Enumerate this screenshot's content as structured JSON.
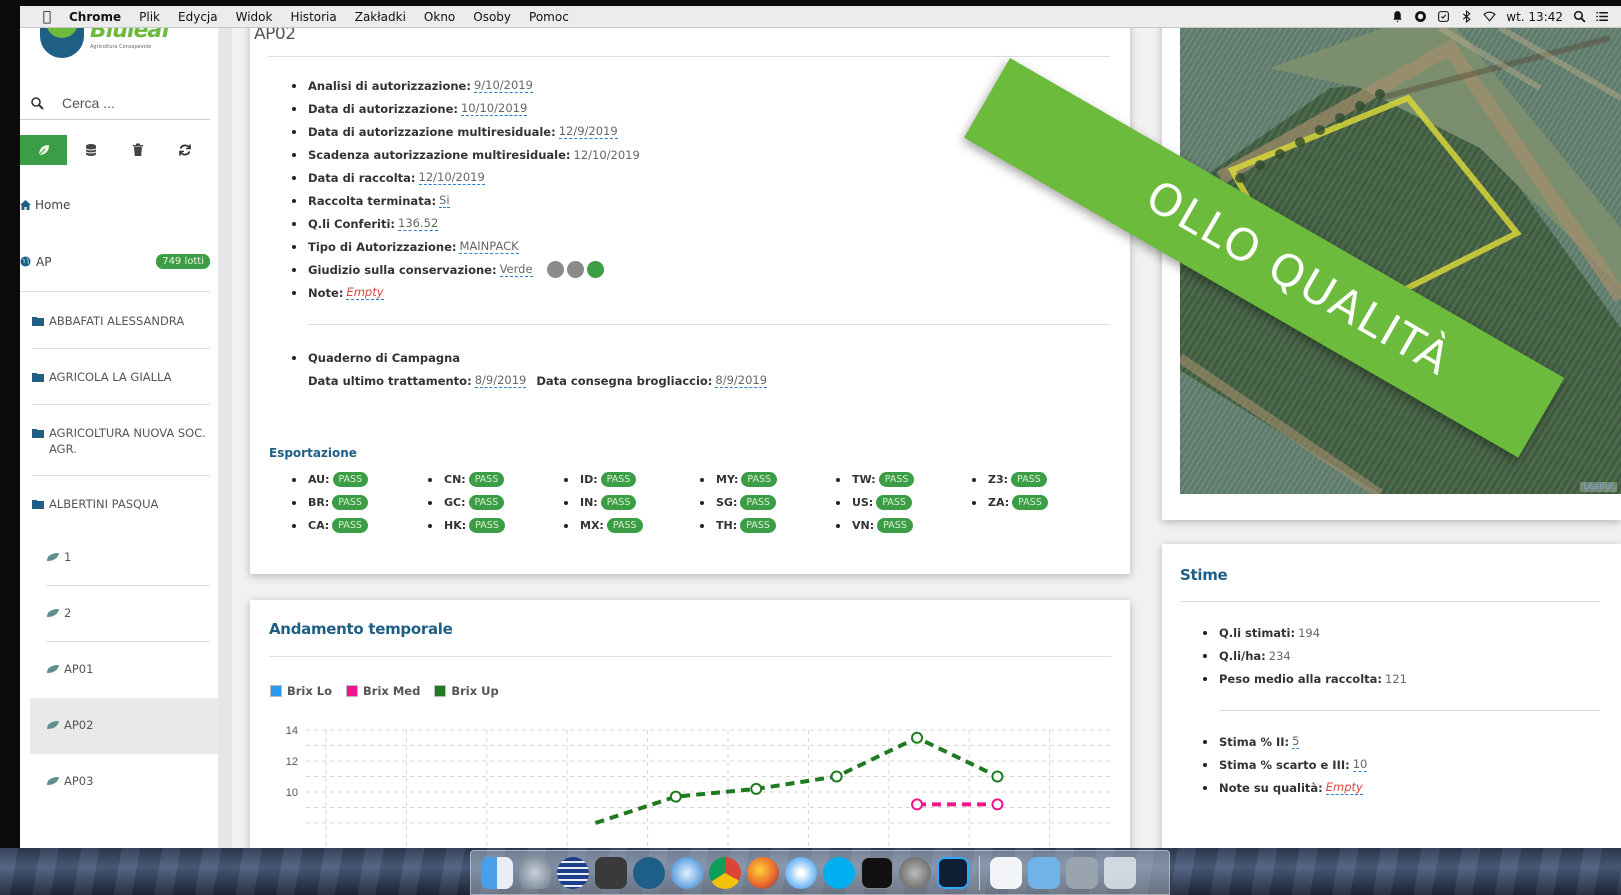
{
  "menubar": {
    "items": [
      "Chrome",
      "Plik",
      "Edycja",
      "Widok",
      "Historia",
      "Zakładki",
      "Okno",
      "Osoby",
      "Pomoc"
    ],
    "clock": "wt. 13:42"
  },
  "sidebar": {
    "brand": "Bluleaf",
    "brand_sub": "Agricoltura Consapevole",
    "search_placeholder": "Cerca ...",
    "home": "Home",
    "ap_label": "AP",
    "ap_badge": "749 lotti",
    "folders": [
      "ABBAFATI ALESSANDRA",
      "AGRICOLA LA GIALLA",
      "AGRICOLTURA NUOVA SOC. AGR.",
      "ALBERTINI PASQUA"
    ],
    "lots": [
      "1",
      "2",
      "AP01",
      "AP02",
      "AP03"
    ]
  },
  "main": {
    "title": "AP02",
    "fields": [
      {
        "label": "Analisi di autorizzazione:",
        "value": "9/10/2019"
      },
      {
        "label": "Data di autorizzazione:",
        "value": "10/10/2019"
      },
      {
        "label": "Data di autorizzazione multiresiduale:",
        "value": "12/9/2019"
      },
      {
        "label": "Scadenza autorizzazione multiresiduale:",
        "value": "12/10/2019"
      },
      {
        "label": "Data di raccolta:",
        "value": "12/10/2019"
      },
      {
        "label": "Raccolta terminata:",
        "value": "Si"
      },
      {
        "label": "Q.li Conferiti:",
        "value": "136.52"
      },
      {
        "label": "Tipo di Autorizzazione:",
        "value": "MAINPACK"
      },
      {
        "label": "Giudizio sulla conservazione:",
        "value": "Verde"
      },
      {
        "label": "Note:",
        "value": "Empty"
      }
    ],
    "quaderno": {
      "title": "Quaderno di Campagna",
      "last_treatment_label": "Data ultimo trattamento:",
      "last_treatment": "8/9/2019",
      "delivery_label": "Data consegna brogliaccio:",
      "delivery": "8/9/2019"
    },
    "export_title": "Esportazione",
    "export": [
      [
        "AU:",
        "BR:",
        "CA:"
      ],
      [
        "CN:",
        "GC:",
        "HK:"
      ],
      [
        "ID:",
        "IN:",
        "MX:"
      ],
      [
        "MY:",
        "SG:",
        "TH:"
      ],
      [
        "TW:",
        "US:",
        "VN:"
      ],
      [
        "Z3:",
        "ZA:"
      ]
    ],
    "pass_label": "PASS"
  },
  "chart_card": {
    "title": "Andamento temporale",
    "legend": [
      {
        "name": "Brix Lo",
        "color": "#2b9bf0"
      },
      {
        "name": "Brix Med",
        "color": "#f0148c"
      },
      {
        "name": "Brix Up",
        "color": "#1f7a1f"
      }
    ]
  },
  "chart_data": {
    "type": "line",
    "ylim": [
      8,
      14
    ],
    "yticks": [
      "14",
      "12",
      "10"
    ],
    "series": [
      {
        "name": "Brix Up",
        "values": [
          null,
          null,
          null,
          8.0,
          9.7,
          10.2,
          11.0,
          13.5,
          11.0,
          null
        ]
      },
      {
        "name": "Brix Med",
        "values": [
          null,
          null,
          null,
          null,
          null,
          null,
          null,
          9.2,
          9.2,
          null
        ]
      }
    ]
  },
  "stime": {
    "title": "Stime",
    "group1": [
      {
        "label": "Q.li stimati:",
        "value": "194"
      },
      {
        "label": "Q.li/ha:",
        "value": "234"
      },
      {
        "label": "Peso medio alla raccolta:",
        "value": "121"
      }
    ],
    "group2": [
      {
        "label": "Stima % II:",
        "value": "5"
      },
      {
        "label": "Stima % scarto e III:",
        "value": "10"
      },
      {
        "label": "Note su qualità:",
        "value": "Empty"
      }
    ]
  },
  "map": {
    "attribution": "Leaflet"
  },
  "banner": {
    "text": "OLLO QUALITÀ"
  },
  "colors": {
    "accent": "#3c9d47",
    "brand_blue": "#1f5f86",
    "banner": "#6dbb3c"
  }
}
